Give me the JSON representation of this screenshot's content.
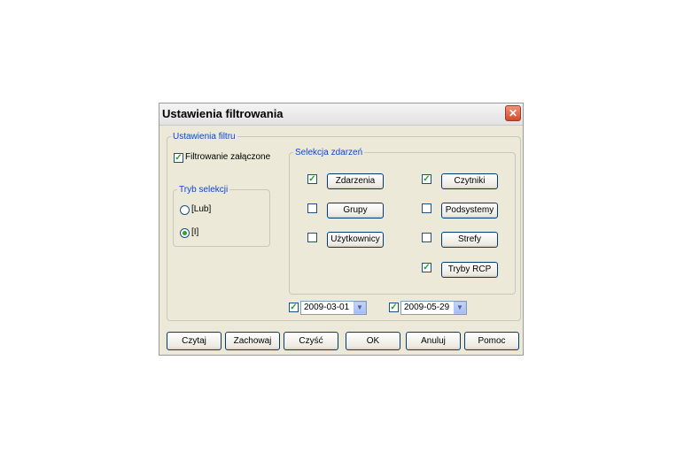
{
  "dialog": {
    "title": "Ustawienia filtrowania",
    "close_glyph": "✕"
  },
  "filter_settings": {
    "legend": "Ustawienia filtru",
    "filtering_enabled": {
      "label": "Filtrowanie załączone",
      "checked": true
    }
  },
  "selection_mode": {
    "legend": "Tryb selekcji",
    "options": [
      {
        "label": "[Lub]",
        "selected": false
      },
      {
        "label": "[I]",
        "selected": true
      }
    ]
  },
  "event_selection": {
    "legend": "Selekcja zdarzeń",
    "items": [
      {
        "label": "Zdarzenia",
        "checked": true
      },
      {
        "label": "Czytniki",
        "checked": true
      },
      {
        "label": "Grupy",
        "checked": false
      },
      {
        "label": "Podsystemy",
        "checked": false
      },
      {
        "label": "Użytkownicy",
        "checked": false
      },
      {
        "label": "Strefy",
        "checked": false
      },
      {
        "label": "Tryby RCP",
        "checked": true
      }
    ]
  },
  "date_range": {
    "from": {
      "value": "2009-03-01",
      "checked": true
    },
    "to": {
      "value": "2009-05-29",
      "checked": true
    }
  },
  "buttons": {
    "read": "Czytaj",
    "save": "Zachowaj",
    "clear": "Czyść",
    "ok": "OK",
    "cancel": "Anuluj",
    "help": "Pomoc"
  },
  "icons": {
    "check": "✓",
    "dropdown": "▼"
  }
}
